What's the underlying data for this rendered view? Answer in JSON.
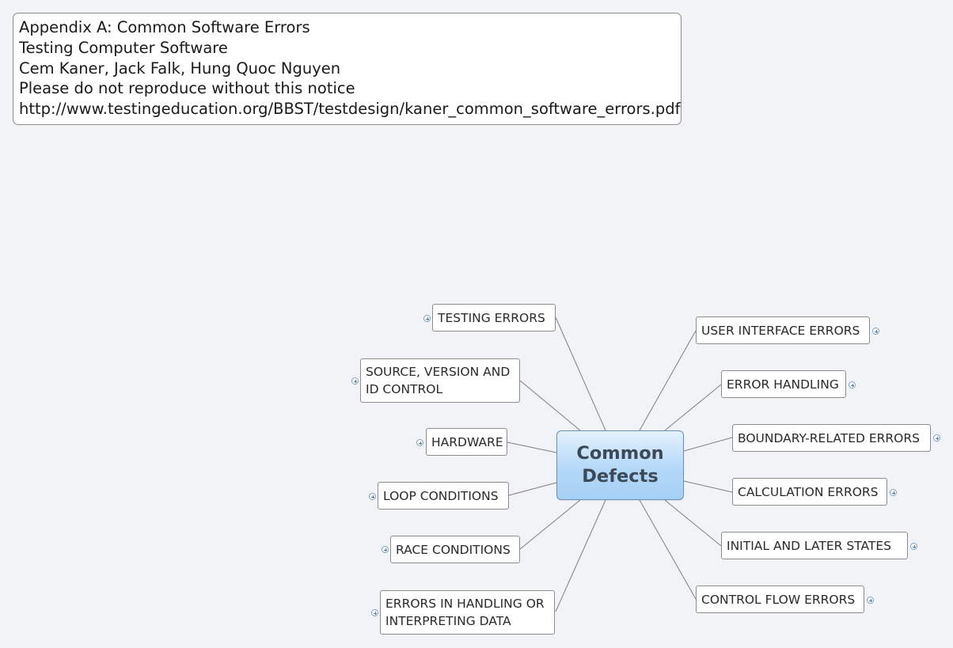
{
  "notice": {
    "lines": [
      "Appendix A: Common Software Errors",
      "Testing Computer Software",
      "Cem Kaner, Jack Falk, Hung Quoc Nguyen",
      "Please do not reproduce without this notice",
      "http://www.testingeducation.org/BBST/testdesign/kaner_common_software_errors.pdf"
    ]
  },
  "central_topic": {
    "label": "Common\nDefects"
  },
  "left_topics": [
    {
      "label": "TESTING ERRORS"
    },
    {
      "label": "SOURCE, VERSION AND\nID CONTROL"
    },
    {
      "label": "HARDWARE"
    },
    {
      "label": "LOOP CONDITIONS"
    },
    {
      "label": "RACE CONDITIONS"
    },
    {
      "label": "ERRORS IN HANDLING OR\nINTERPRETING DATA"
    }
  ],
  "right_topics": [
    {
      "label": "USER INTERFACE ERRORS"
    },
    {
      "label": "ERROR HANDLING"
    },
    {
      "label": "BOUNDARY-RELATED ERRORS"
    },
    {
      "label": "CALCULATION ERRORS"
    },
    {
      "label": "INITIAL AND LATER STATES"
    },
    {
      "label": "CONTROL FLOW ERRORS"
    }
  ],
  "colors": {
    "background": "#f1f3f7",
    "connector": "#7f7f7f",
    "central_border": "#6a8fb3",
    "central_text": "#3c4a57"
  }
}
